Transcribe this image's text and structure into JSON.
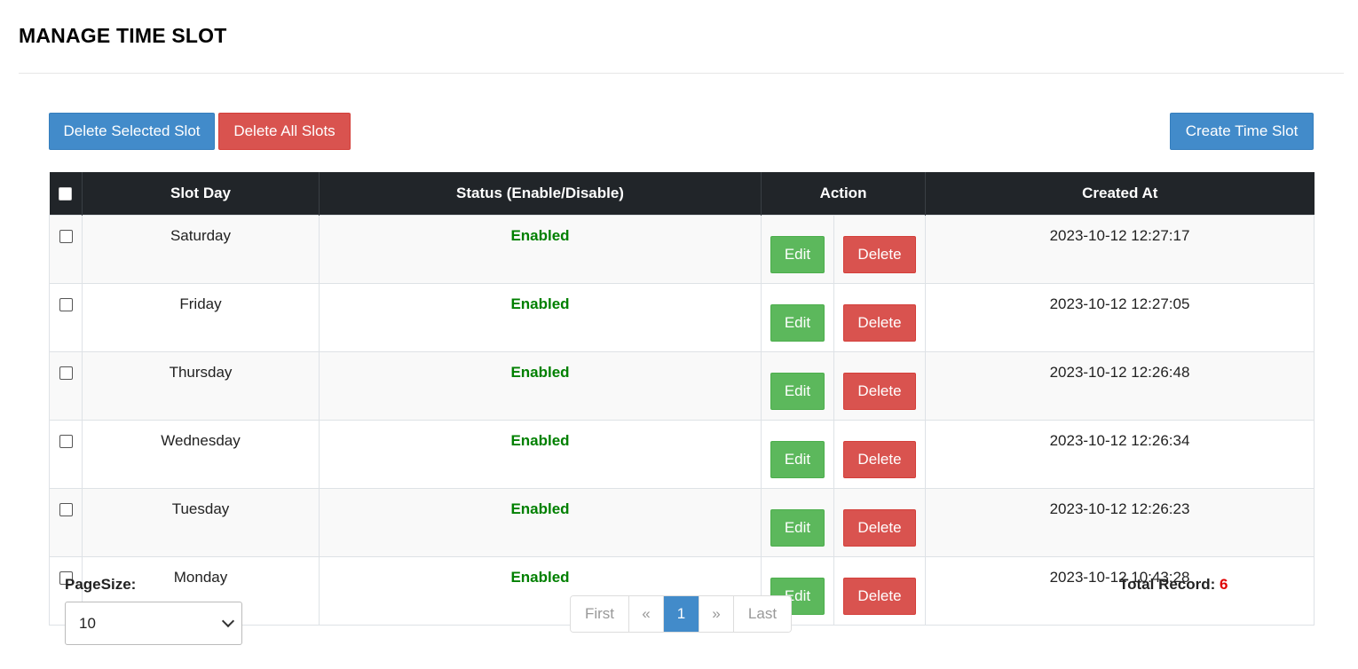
{
  "page": {
    "title": "MANAGE TIME SLOT"
  },
  "toolbar": {
    "delete_selected": "Delete Selected Slot",
    "delete_all": "Delete All Slots",
    "create": "Create Time Slot"
  },
  "table": {
    "headers": {
      "slot_day": "Slot Day",
      "status": "Status (Enable/Disable)",
      "action": "Action",
      "created_at": "Created At"
    },
    "edit_label": "Edit",
    "delete_label": "Delete",
    "rows": [
      {
        "day": "Saturday",
        "status": "Enabled",
        "created": "2023-10-12 12:27:17"
      },
      {
        "day": "Friday",
        "status": "Enabled",
        "created": "2023-10-12 12:27:05"
      },
      {
        "day": "Thursday",
        "status": "Enabled",
        "created": "2023-10-12 12:26:48"
      },
      {
        "day": "Wednesday",
        "status": "Enabled",
        "created": "2023-10-12 12:26:34"
      },
      {
        "day": "Tuesday",
        "status": "Enabled",
        "created": "2023-10-12 12:26:23"
      },
      {
        "day": "Monday",
        "status": "Enabled",
        "created": "2023-10-12 10:43:28"
      }
    ]
  },
  "footer": {
    "pagesize_label": "PageSize:",
    "pagesize_value": "10",
    "pager": [
      "First",
      "«",
      "1",
      "»",
      "Last"
    ],
    "pager_active": "1",
    "total_label": "Total Record:",
    "total_count": "6"
  },
  "colors": {
    "primary": "#428bca",
    "danger": "#d9534f",
    "success": "#5cb85c",
    "enabled_text": "#008000",
    "total_count": "#e00000"
  }
}
